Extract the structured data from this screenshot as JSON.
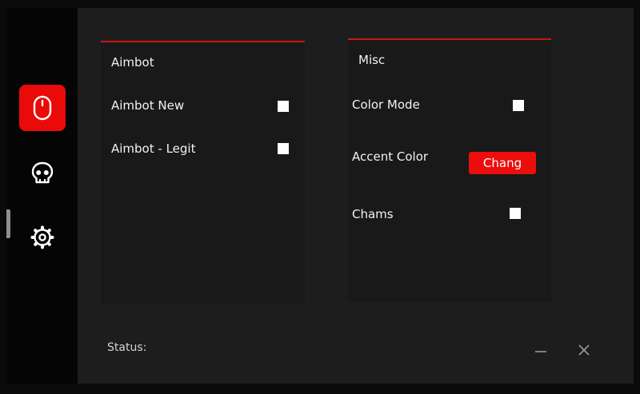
{
  "sidebar": {
    "items": [
      {
        "icon": "mouse-icon",
        "active": true
      },
      {
        "icon": "skull-icon",
        "active": false
      },
      {
        "icon": "gear-icon",
        "active": false
      }
    ]
  },
  "aimbot_panel": {
    "title": "Aimbot",
    "rows": [
      {
        "label": "Aimbot New",
        "checked": false
      },
      {
        "label": "Aimbot - Legit",
        "checked": false
      }
    ]
  },
  "misc_panel": {
    "title": "Misc",
    "color_mode_label": "Color Mode",
    "accent_color_label": "Accent Color",
    "change_button_label": "Chang",
    "chams_label": "Chams"
  },
  "status": {
    "label": "Status:"
  },
  "colors": {
    "accent": "#ea0a0a",
    "background": "#1d1d1d",
    "sidebar": "#050505"
  }
}
